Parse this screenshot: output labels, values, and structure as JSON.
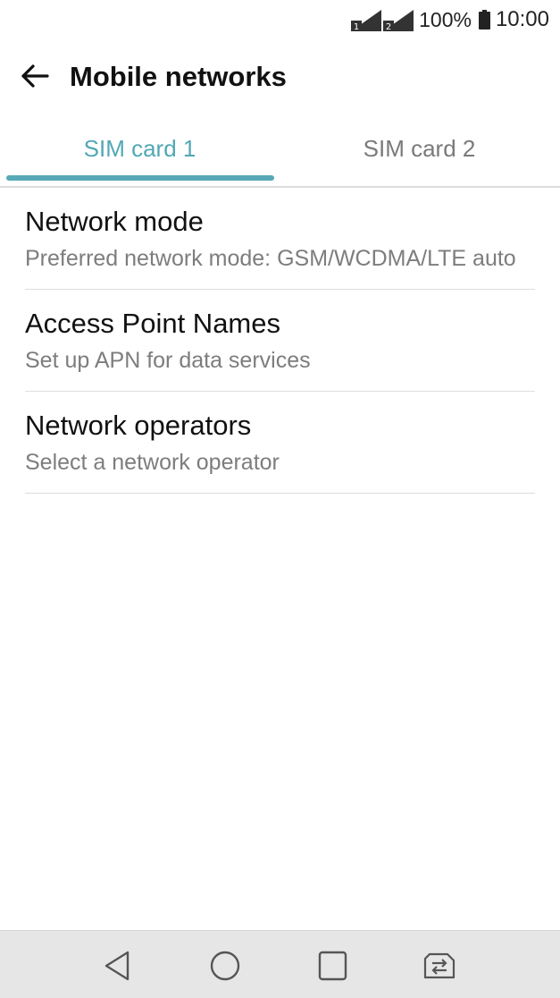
{
  "status_bar": {
    "sim1_badge": "1",
    "sim2_badge": "2",
    "battery_percent": "100%",
    "time": "10:00",
    "icons": [
      "signal-sim1-icon",
      "signal-sim2-icon",
      "battery-icon"
    ]
  },
  "app_bar": {
    "back_icon": "arrow-left-icon",
    "title": "Mobile networks"
  },
  "tabs": [
    {
      "label": "SIM card 1",
      "active": true
    },
    {
      "label": "SIM card 2",
      "active": false
    }
  ],
  "accent_color": "#57a9b7",
  "settings": [
    {
      "title": "Network mode",
      "subtitle": "Preferred network mode: GSM/WCDMA/LTE auto"
    },
    {
      "title": "Access Point Names",
      "subtitle": "Set up APN for data services"
    },
    {
      "title": "Network operators",
      "subtitle": "Select a network operator"
    }
  ],
  "nav_bar": {
    "icons": [
      "nav-back-triangle-icon",
      "nav-home-circle-icon",
      "nav-recents-square-icon",
      "sim-switch-icon"
    ]
  }
}
